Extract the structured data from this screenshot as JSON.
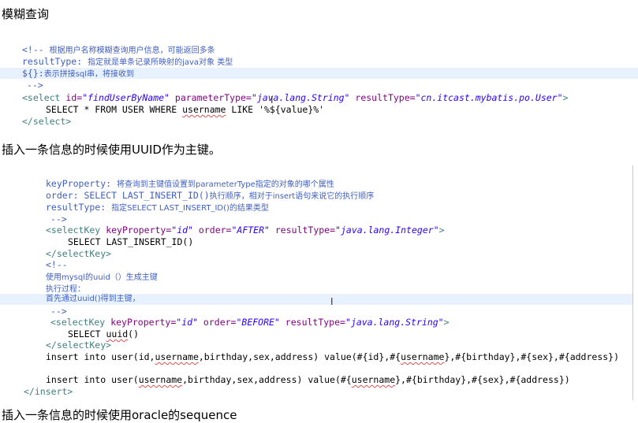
{
  "headings": {
    "fuzzy": "模糊查询",
    "uuid": "插入一条信息的时候使用UUID作为主键。",
    "oracle": "插入一条信息的时候使用oracle的sequence"
  },
  "block1": {
    "comment_open": "<!--",
    "comment1": "根据用户名称模糊查询用户信息，可能返回多条",
    "rt_label": "resultType:",
    "rt_desc": "指定就是单条记录所映射的java对象 类型",
    "dollar_label": "${}:",
    "dollar_desc": "表示拼接sql串，将接收到",
    "comment_close": "-->",
    "select_open": "<select",
    "id_attr": "id=",
    "id_val": "\"findUserByName\"",
    "pt_attr": "parameterType=",
    "pt_val": "\"java.lang.String\"",
    "rt_attr": "resultType=",
    "rt_val": "\"cn.itcast.mybatis.po.User\"",
    "tag_close": ">",
    "sql_a": "SELECT * FROM USER WHERE ",
    "sql_user": "username",
    "sql_b": " LIKE '%${value}%'",
    "select_end": "</select>"
  },
  "block2": {
    "kp_label": "keyProperty:",
    "kp_desc": "将查询到主键值设置到parameterType指定的对象的哪个属性",
    "order_label": "order: SELECT LAST_INSERT_ID()",
    "order_desc": "执行顺序，相对于insert语句来说它的执行顺序",
    "rt_label": "resultType:",
    "rt_desc": "指定SELECT LAST_INSERT_ID()的结果类型",
    "comment_close": "-->",
    "sk_open": "<selectKey",
    "kp_attr": "keyProperty=",
    "kp_val": "\"id\"",
    "order_attr": "order=",
    "order_after": "\"AFTER\"",
    "rt_attr": "resultType=",
    "rt_val": "\"java.lang.Integer\"",
    "tag_close": ">",
    "sql_last_id": "SELECT LAST_INSERT_ID()",
    "sk_end": "</selectKey>",
    "comment_open": "<!--",
    "uuid_note1": "使用mysql的uuid（）生成主键",
    "uuid_note2": "执行过程：",
    "uuid_note3": "首先通过uuid()得到主键，",
    "order_before": "\"BEFORE\"",
    "rt_val2": "\"java.lang.String\"",
    "sql_uuid_a": "SELECT ",
    "sql_uuid_b": "uuid",
    "sql_uuid_c": "()",
    "insert1_a": "insert into user(id,",
    "insert1_user": "username",
    "insert1_b": ",birthday,sex,address) value(#{id},#{",
    "insert1_user2": "username",
    "insert1_c": "},#{birthday},#{sex},#{address})",
    "insert2_a": "insert into user(",
    "insert2_user": "username",
    "insert2_b": ",birthday,sex,address) value(#{",
    "insert2_user2": "username",
    "insert2_c": "},#{birthday},#{sex},#{address})",
    "insert_end": "</insert>"
  }
}
